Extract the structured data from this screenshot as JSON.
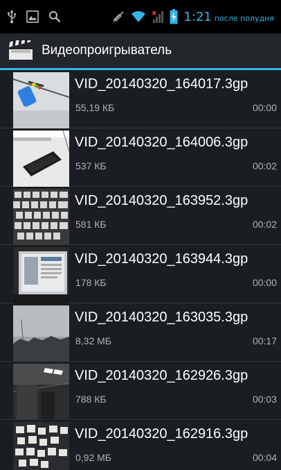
{
  "status_bar": {
    "time": "1:21",
    "ampm": "после полудня",
    "icons": [
      "usb-icon",
      "image-icon",
      "search-icon",
      "mute-icon",
      "wifi-icon",
      "no-signal-icon",
      "battery-charging-icon"
    ]
  },
  "app": {
    "title": "Видеопроигрыватель",
    "icon": "clapperboard-icon"
  },
  "colors": {
    "accent": "#33b5e5",
    "background": "#1a1d21",
    "action_bar": "#222529"
  },
  "videos": [
    {
      "name": "VID_20140320_164017.3gp",
      "size": "55,19 КБ",
      "duration": "00:00"
    },
    {
      "name": "VID_20140320_164006.3gp",
      "size": "537 КБ",
      "duration": "00:02"
    },
    {
      "name": "VID_20140320_163952.3gp",
      "size": "581 КБ",
      "duration": "00:02"
    },
    {
      "name": "VID_20140320_163944.3gp",
      "size": "178 КБ",
      "duration": "00:00"
    },
    {
      "name": "VID_20140320_163035.3gp",
      "size": "8,32 МБ",
      "duration": "00:17"
    },
    {
      "name": "VID_20140320_162926.3gp",
      "size": "788 КБ",
      "duration": "00:03"
    },
    {
      "name": "VID_20140320_162916.3gp",
      "size": "0,92 МБ",
      "duration": "00:04"
    }
  ]
}
